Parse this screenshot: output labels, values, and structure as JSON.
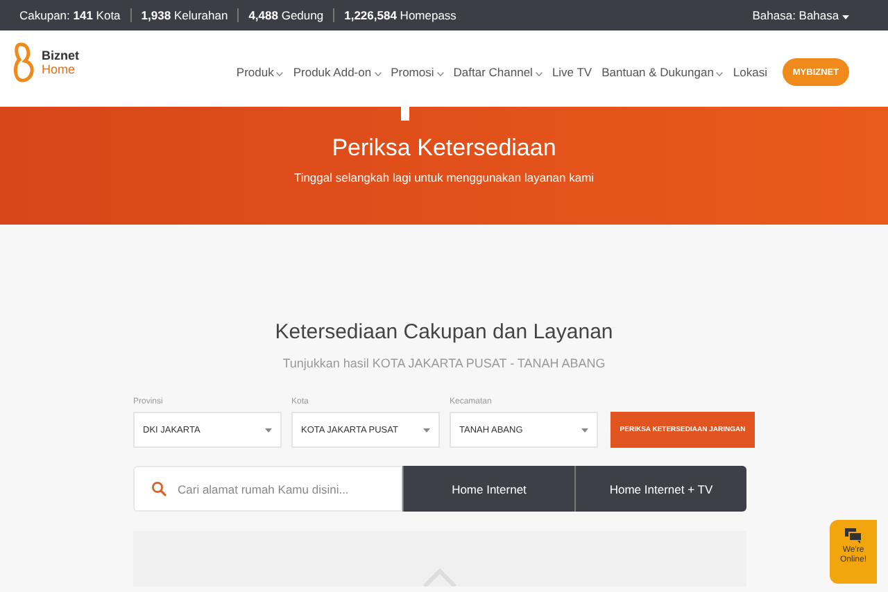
{
  "top_bar": {
    "stats": [
      "Cakupan: **141** Kota",
      "**1,938** Kelurahan",
      "**4,488** Gedung",
      "**1,226,584** Homepass"
    ],
    "language": "Bahasa: Bahasa"
  },
  "logo": {
    "line1": "Biznet",
    "line2": "Home"
  },
  "nav": [
    {
      "label": "Produk",
      "dropdown": true
    },
    {
      "label": "Produk Add-on",
      "dropdown": true
    },
    {
      "label": "Promosi",
      "dropdown": true
    },
    {
      "label": "Daftar Channel",
      "dropdown": true
    },
    {
      "label": "Live TV",
      "dropdown": false
    },
    {
      "label": "Bantuan & Dukungan",
      "dropdown": true
    },
    {
      "label": "Lokasi",
      "dropdown": false
    }
  ],
  "nav_button": "MYBIZNET",
  "banner": {
    "title": "Periksa Ketersediaan",
    "subtitle": "Tinggal selangkah lagi untuk menggunakan layanan kami"
  },
  "section": {
    "title": "Ketersediaan Cakupan dan Layanan",
    "subtitle": "Tunjukkan hasil KOTA JAKARTA PUSAT - TANAH ABANG"
  },
  "selects": [
    {
      "label": "Provinsi",
      "value": "DKI JAKARTA"
    },
    {
      "label": "Kota",
      "value": "KOTA JAKARTA PUSAT"
    },
    {
      "label": "Kecamatan",
      "value": "TANAH ABANG"
    }
  ],
  "check_button": "PERIKSA KETERSEDIAAN JARINGAN",
  "search": {
    "placeholder": "Cari alamat rumah Kamu disini..."
  },
  "service_tabs": [
    "Home Internet",
    "Home Internet + TV"
  ],
  "chat": {
    "label": "We're Online!"
  }
}
